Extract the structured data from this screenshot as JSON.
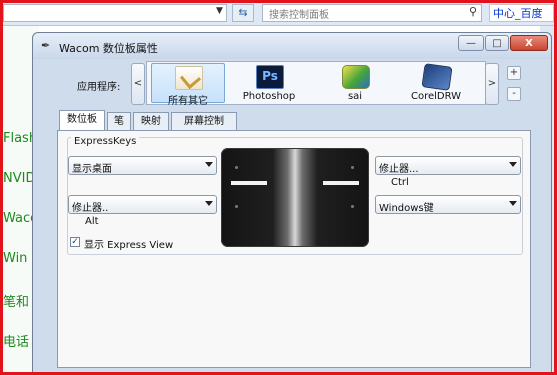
{
  "background_window": {
    "search_placeholder": "搜索控制面板",
    "right_tab_label": "中心_百度",
    "sidebar_items": [
      "Flash",
      "NVID",
      "Waco",
      "Win",
      "笔和",
      "电话"
    ]
  },
  "dialog": {
    "title": "Wacom 数位板属性",
    "window_buttons": {
      "minimize": "—",
      "maximize": "□",
      "close": "X"
    },
    "app_label": "应用程序:",
    "scroll_left": "<",
    "scroll_right": ">",
    "add_button": "+",
    "remove_button": "-",
    "applications": [
      {
        "name": "所有其它",
        "icon": "all-other-apps-icon",
        "selected": true
      },
      {
        "name": "Photoshop",
        "icon": "photoshop-icon",
        "icon_text": "Ps",
        "selected": false
      },
      {
        "name": "sai",
        "icon": "sai-icon",
        "selected": false
      },
      {
        "name": "CorelDRW",
        "icon": "coreldraw-icon",
        "selected": false
      }
    ],
    "tabs": [
      {
        "label": "数位板",
        "active": true
      },
      {
        "label": "笔",
        "active": false
      },
      {
        "label": "映射",
        "active": false
      },
      {
        "label": "屏幕控制",
        "active": false
      }
    ],
    "expresskeys": {
      "group_title": "ExpressKeys",
      "left_top": "显示桌面",
      "left_bottom": "修止器..",
      "left_bottom_note": "Alt",
      "right_top": "修止器...",
      "right_top_note": "Ctrl",
      "right_bottom": "Windows键"
    },
    "show_express_view": {
      "label": "显示 Express View",
      "checked": true,
      "check_mark": "✓"
    }
  },
  "colors": {
    "frame": "#e3131b",
    "dialog_bg": "#cfdcec",
    "accent_link": "#1d8a1d"
  }
}
